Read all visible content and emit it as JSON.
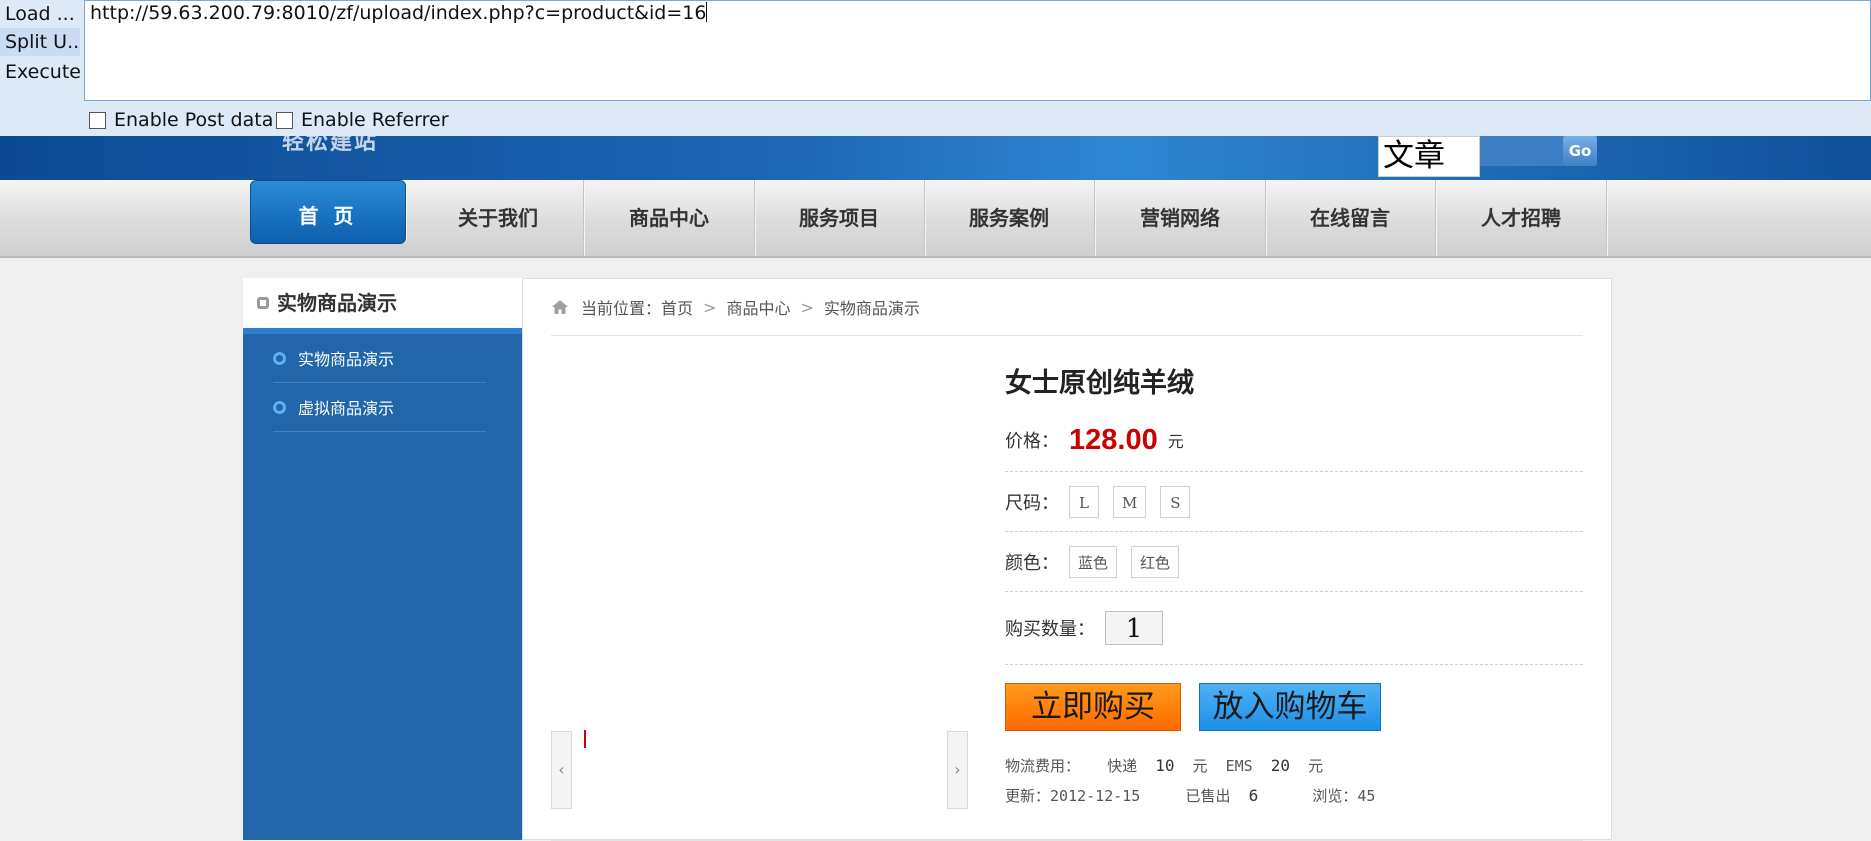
{
  "hackbar": {
    "buttons": [
      "Load ...",
      "Split U...",
      "Execute"
    ],
    "url": "http://59.63.200.79:8010/zf/upload/index.php?c=product&id=16",
    "enable_post": "Enable Post data",
    "enable_referrer": "Enable Referrer"
  },
  "header": {
    "slogan": "轻松建站",
    "search_value": "文章",
    "search_go": "Go"
  },
  "nav": [
    "首 页",
    "关于我们",
    "商品中心",
    "服务项目",
    "服务案例",
    "营销网络",
    "在线留言",
    "人才招聘"
  ],
  "sidebar": {
    "title": "实物商品演示",
    "items": [
      "实物商品演示",
      "虚拟商品演示"
    ]
  },
  "breadcrumb": {
    "prefix": "当前位置：",
    "items": [
      "首页",
      "商品中心",
      "实物商品演示"
    ],
    "separator": ">"
  },
  "product": {
    "title": "女士原创纯羊绒",
    "price_label": "价格：",
    "price": "128.00",
    "price_unit": "元",
    "size_label": "尺码：",
    "sizes": [
      "L",
      "M",
      "S"
    ],
    "color_label": "颜色：",
    "colors": [
      "蓝色",
      "红色"
    ],
    "qty_label": "购买数量：",
    "qty": "1",
    "buy_label": "立即购买",
    "cart_label": "放入购物车",
    "shipping_label": "物流费用：",
    "express_label": "快递",
    "express_price": "10",
    "ems_label": "EMS",
    "ems_price": "20",
    "currency": "元",
    "update_label": "更新：",
    "update_date": "2012-12-15",
    "sold_label": "已售出",
    "sold": "6",
    "views_label": "浏览：",
    "views": "45"
  },
  "gallery": {
    "prev": "‹",
    "next": "›"
  },
  "colors": {
    "accent_blue": "#2066a9",
    "price_red": "#cc0000",
    "buy_orange": "#ff7a00",
    "cart_blue": "#2b9ae9"
  }
}
